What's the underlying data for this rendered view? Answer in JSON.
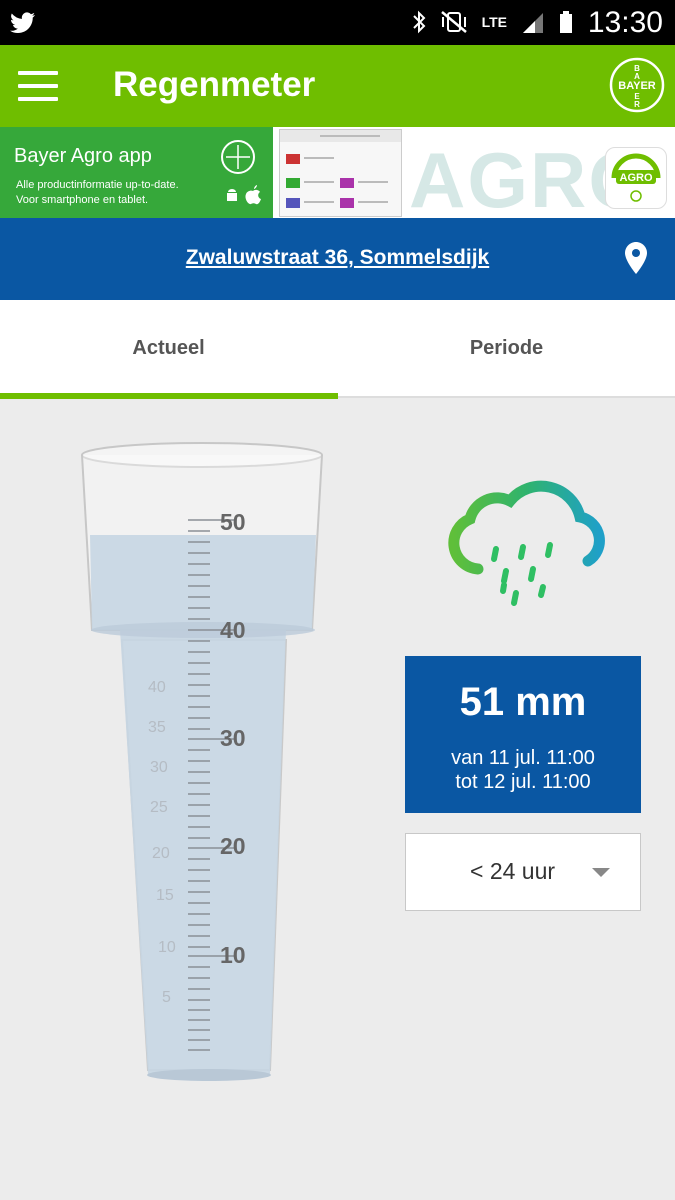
{
  "status_bar": {
    "time": "13:30",
    "network": "LTE"
  },
  "app_bar": {
    "title": "Regenmeter",
    "logo_text": "BAYER"
  },
  "banner": {
    "title": "Bayer Agro app",
    "subtitle_line1": "Alle productinformatie up-to-date.",
    "subtitle_line2": "Voor smartphone en tablet.",
    "brand_word": "AGRO"
  },
  "location": {
    "address": "Zwaluwstraat 36, Sommelsdijk"
  },
  "tabs": [
    {
      "label": "Actueel",
      "active": true
    },
    {
      "label": "Periode",
      "active": false
    }
  ],
  "gauge": {
    "scale_labels": [
      "50",
      "40",
      "30",
      "20",
      "10"
    ],
    "max": 50,
    "fill_level_mm": 51
  },
  "result": {
    "value": "51 mm",
    "from": "van 11 jul. 11:00",
    "to": "tot 12 jul. 11:00"
  },
  "period_select": {
    "selected": "< 24 uur"
  },
  "colors": {
    "green": "#6fbe00",
    "blue": "#0a57a3",
    "background": "#ececec"
  }
}
